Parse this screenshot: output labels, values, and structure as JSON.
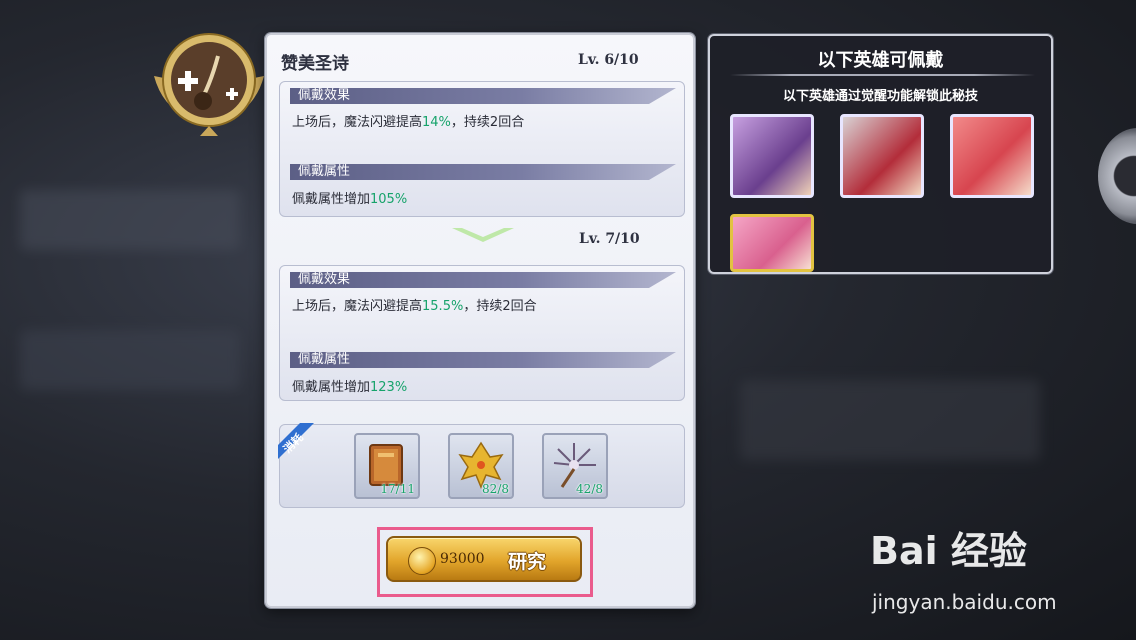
{
  "skill": {
    "name": "赞美圣诗",
    "current_level": "Lv.  6/10",
    "next_level": "Lv.  7/10"
  },
  "current": {
    "effect_header": "佩戴效果",
    "effect_text_pre": "上场后，魔法闪避提高",
    "effect_value": "14%",
    "effect_text_post": "，持续2回合",
    "attr_header": "佩戴属性",
    "attr_text_pre": "佩戴属性增加",
    "attr_value": "105%"
  },
  "next": {
    "effect_header": "佩戴效果",
    "effect_text_pre": "上场后，魔法闪避提高",
    "effect_value": "15.5%",
    "effect_text_post": "，持续2回合",
    "attr_header": "佩戴属性",
    "attr_text_pre": "佩戴属性增加",
    "attr_value": "123%"
  },
  "cost": {
    "tag": "消耗",
    "items": [
      {
        "icon": "book-icon",
        "count": "17/11"
      },
      {
        "icon": "golden-leaf-icon",
        "count": "82/8"
      },
      {
        "icon": "feather-fan-icon",
        "count": "42/8"
      }
    ]
  },
  "research_button": {
    "price": "93000",
    "label": "研究"
  },
  "heroes_panel": {
    "title": "以下英雄可佩戴",
    "subtitle": "以下英雄通过觉醒功能解锁此秘技",
    "heroes": [
      {
        "icon": "hero-portrait-purple-hair"
      },
      {
        "icon": "hero-portrait-silver-hair"
      },
      {
        "icon": "hero-portrait-red-hair"
      },
      {
        "icon": "hero-portrait-pink-hair"
      }
    ]
  },
  "watermark": {
    "brand": "Bai 经验",
    "url": "jingyan.baidu.com"
  },
  "colors": {
    "highlight_value": "#17a36b",
    "header_bar": "#5c5f86",
    "button_frame": "#ea5b8c",
    "button_gold": "#e2a52b"
  }
}
